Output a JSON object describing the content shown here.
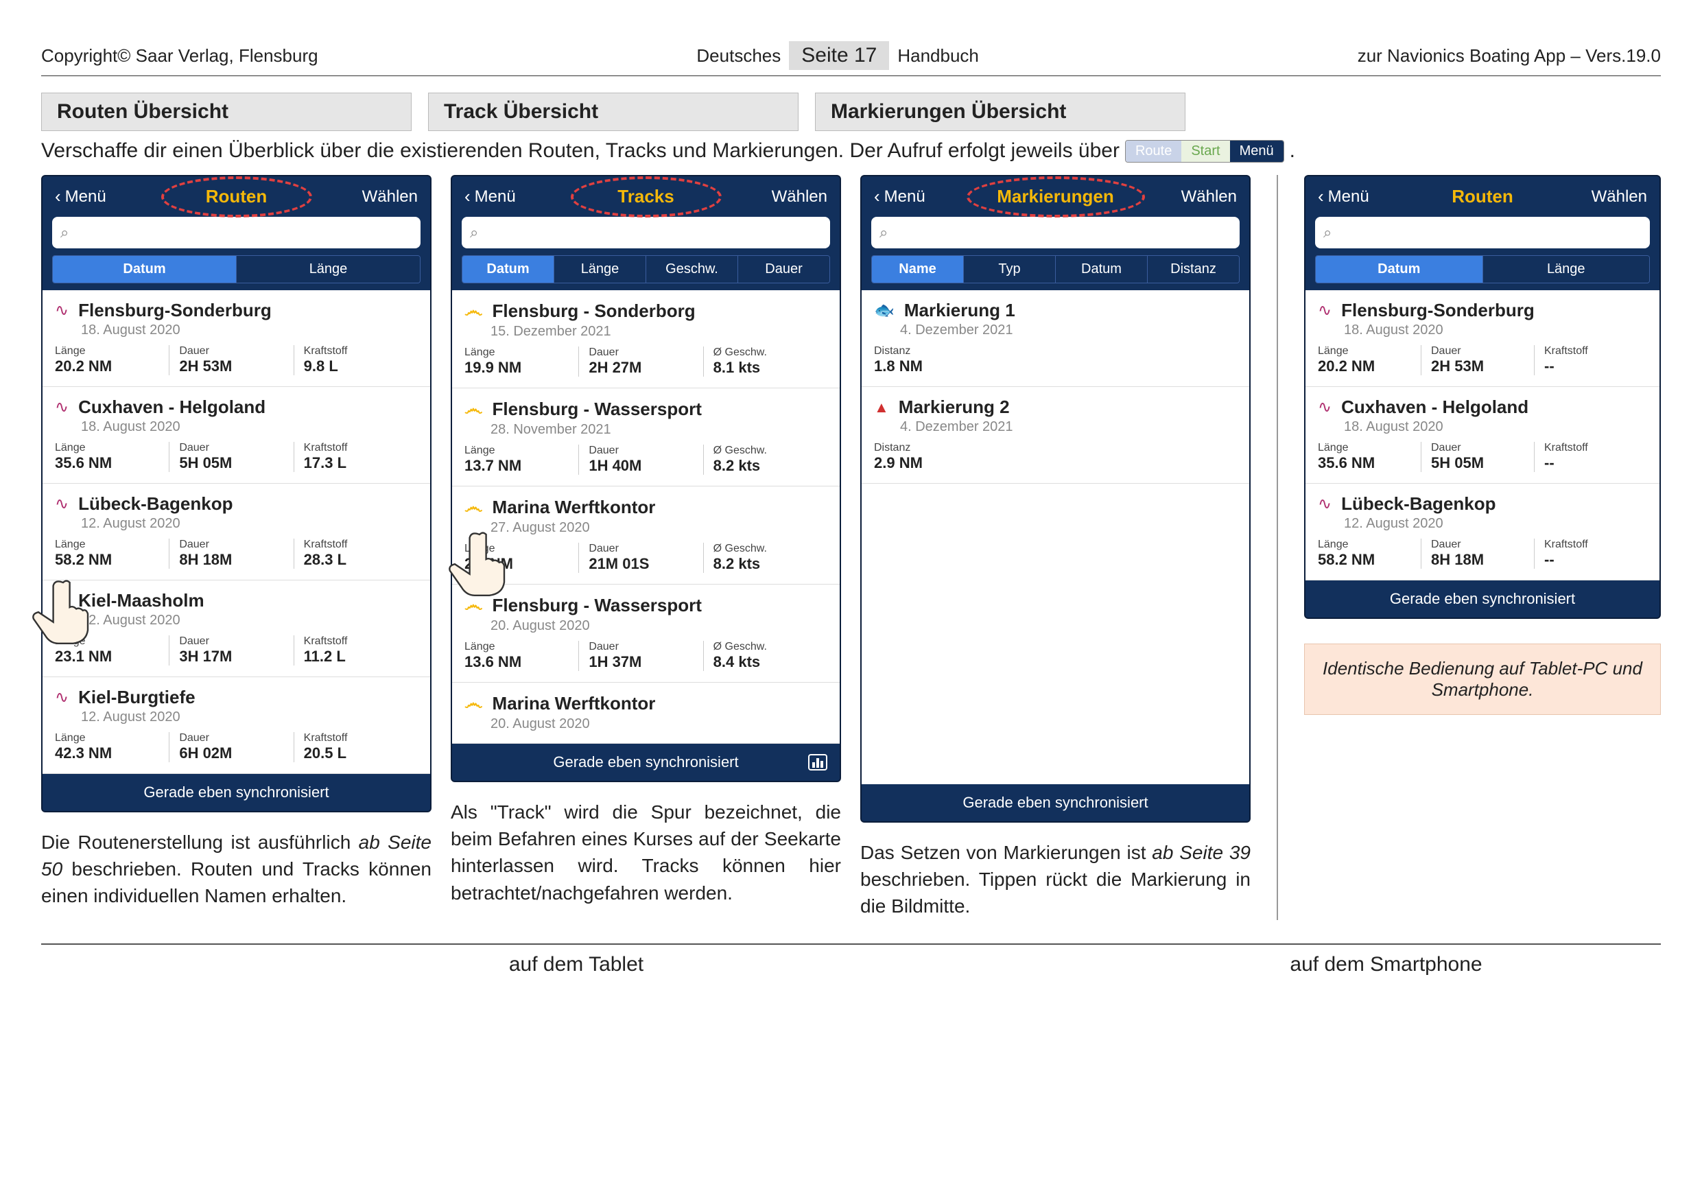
{
  "header": {
    "copyright": "Copyright© Saar Verlag, Flensburg",
    "center_left": "Deutsches",
    "page": "Seite 17",
    "center_right": "Handbuch",
    "right": "zur Navionics Boating App – Vers.19.0"
  },
  "section_tabs": {
    "routen": "Routen Übersicht",
    "tracks": "Track Übersicht",
    "mark": "Markierungen Übersicht"
  },
  "intro": {
    "text": "Verschaffe dir einen Überblick über die existierenden Routen, Tracks und Markierungen. Der Aufruf erfolgt jeweils über",
    "btn": {
      "route": "Route",
      "start": "Start",
      "menu": "Menü"
    },
    "period": "."
  },
  "common": {
    "back_label": "Menü",
    "select_label": "Wählen",
    "search_icon": "⌕",
    "sync_footer": "Gerade eben synchronisiert"
  },
  "routes": {
    "title": "Routen",
    "sort": {
      "datum": "Datum",
      "laenge": "Länge"
    },
    "stat_labels": {
      "laenge": "Länge",
      "dauer": "Dauer",
      "kraft": "Kraftstoff"
    },
    "items": [
      {
        "name": "Flensburg-Sonderburg",
        "date": "18. August 2020",
        "laenge": "20.2 NM",
        "dauer": "2H 53M",
        "kraft": "9.8 L"
      },
      {
        "name": "Cuxhaven - Helgoland",
        "date": "18. August 2020",
        "laenge": "35.6 NM",
        "dauer": "5H 05M",
        "kraft": "17.3 L"
      },
      {
        "name": "Lübeck-Bagenkop",
        "date": "12. August 2020",
        "laenge": "58.2 NM",
        "dauer": "8H 18M",
        "kraft": "28.3 L"
      },
      {
        "name": "Kiel-Maasholm",
        "date": "12. August 2020",
        "laenge": "23.1 NM",
        "dauer": "3H 17M",
        "kraft": "11.2 L"
      },
      {
        "name": "Kiel-Burgtiefe",
        "date": "12. August 2020",
        "laenge": "42.3 NM",
        "dauer": "6H 02M",
        "kraft": "20.5 L"
      }
    ],
    "caption_a": "Die Routenerstellung ist ausführlich ",
    "caption_em": "ab Seite 50",
    "caption_b": " beschrieben. Routen und Tracks können einen individuellen Namen erhalten."
  },
  "tracks": {
    "title": "Tracks",
    "sort": {
      "datum": "Datum",
      "laenge": "Länge",
      "geschw": "Geschw.",
      "dauer": "Dauer"
    },
    "stat_labels": {
      "laenge": "Länge",
      "dauer": "Dauer",
      "geschw": "Ø Geschw."
    },
    "items": [
      {
        "name": "Flensburg - Sonderborg",
        "date": "15. Dezember 2021",
        "laenge": "19.9 NM",
        "dauer": "2H 27M",
        "geschw": "8.1 kts"
      },
      {
        "name": "Flensburg - Wassersport",
        "date": "28. November 2021",
        "laenge": "13.7 NM",
        "dauer": "1H 40M",
        "geschw": "8.2 kts"
      },
      {
        "name": "Marina Werftkontor",
        "date": "27. August 2020",
        "laenge": "2.9 NM",
        "dauer": "21M 01S",
        "geschw": "8.2 kts"
      },
      {
        "name": "Flensburg - Wassersport",
        "date": "20. August 2020",
        "laenge": "13.6 NM",
        "dauer": "1H 37M",
        "geschw": "8.4 kts"
      },
      {
        "name": "Marina Werftkontor",
        "date": "20. August 2020",
        "laenge": "",
        "dauer": "",
        "geschw": ""
      }
    ],
    "caption": "Als \"Track\" wird die Spur bezeichnet, die beim Befahren eines Kurses auf der Seekarte hinterlassen wird. Tracks können hier betrachtet/nachgefahren werden."
  },
  "marks": {
    "title": "Markierungen",
    "sort": {
      "name": "Name",
      "typ": "Typ",
      "datum": "Datum",
      "distanz": "Distanz"
    },
    "stat_labels": {
      "distanz": "Distanz"
    },
    "items": [
      {
        "name": "Markierung 1",
        "date": "4. Dezember 2021",
        "distanz": "1.8 NM",
        "icon": "fish"
      },
      {
        "name": "Markierung 2",
        "date": "4. Dezember 2021",
        "distanz": "2.9 NM",
        "icon": "warn"
      }
    ],
    "caption_a": "Das Setzen von Markierungen ist ",
    "caption_em": "ab Seite 39",
    "caption_b": " beschrieben. Tippen rückt die Markierung in die Bildmitte."
  },
  "phone2": {
    "title": "Routen",
    "sort": {
      "datum": "Datum",
      "laenge": "Länge"
    },
    "stat_labels": {
      "laenge": "Länge",
      "dauer": "Dauer",
      "kraft": "Kraftstoff"
    },
    "items": [
      {
        "name": "Flensburg-Sonderburg",
        "date": "18. August 2020",
        "laenge": "20.2 NM",
        "dauer": "2H 53M",
        "kraft": "--"
      },
      {
        "name": "Cuxhaven - Helgoland",
        "date": "18. August 2020",
        "laenge": "35.6 NM",
        "dauer": "5H 05M",
        "kraft": "--"
      },
      {
        "name": "Lübeck-Bagenkop",
        "date": "12. August 2020",
        "laenge": "58.2 NM",
        "dauer": "8H 18M",
        "kraft": "--"
      }
    ]
  },
  "note": "Identische Bedienung auf Tablet-PC und Smartphone.",
  "bottom": {
    "tablet": "auf dem Tablet",
    "smartphone": "auf dem Smartphone"
  }
}
